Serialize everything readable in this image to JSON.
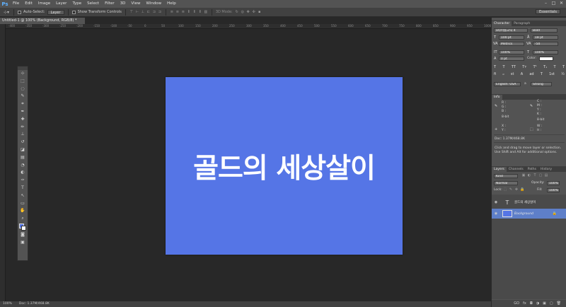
{
  "app": {
    "logo": "Ps",
    "menu": [
      "File",
      "Edit",
      "Image",
      "Layer",
      "Type",
      "Select",
      "Filter",
      "3D",
      "View",
      "Window",
      "Help"
    ],
    "window_controls": [
      "–",
      "□",
      "✕"
    ]
  },
  "options_bar": {
    "auto_select_label": "Auto-Select:",
    "auto_select_value": "Layer",
    "show_transform_label": "Show Transform Controls",
    "mode_label": "3D Mode:",
    "workspace": "Essentials"
  },
  "document": {
    "tab_title": "Untitled-1 @ 100% (Background, RGB/8) *",
    "canvas_color": "#5575e6",
    "canvas_text": "골드의 세상살이",
    "ruler_labels": [
      "-400",
      "-350",
      "-300",
      "-250",
      "-200",
      "-150",
      "-100",
      "-50",
      "0",
      "50",
      "100",
      "150",
      "200",
      "250",
      "300",
      "350",
      "400",
      "450",
      "500",
      "550",
      "600",
      "650",
      "700",
      "750",
      "800",
      "850",
      "900",
      "950",
      "1000",
      "1050"
    ]
  },
  "status": {
    "zoom": "100%",
    "doc_size": "Doc: 1.37M/468.8K"
  },
  "tools": {
    "icons": [
      "move-tool-icon",
      "marquee-tool-icon",
      "lasso-tool-icon",
      "quick-select-tool-icon",
      "crop-tool-icon",
      "eyedropper-tool-icon",
      "healing-brush-tool-icon",
      "brush-tool-icon",
      "clone-stamp-tool-icon",
      "history-brush-tool-icon",
      "eraser-tool-icon",
      "gradient-tool-icon",
      "blur-tool-icon",
      "dodge-tool-icon",
      "pen-tool-icon",
      "type-tool-icon",
      "path-select-tool-icon",
      "shape-tool-icon",
      "hand-tool-icon",
      "zoom-tool-icon"
    ],
    "glyphs": [
      "⊹",
      "⬚",
      "◌",
      "✎",
      "⌗",
      "✒",
      "✚",
      "✏",
      "⊥",
      "↺",
      "◪",
      "▤",
      "◔",
      "◐",
      "✑",
      "T",
      "↖",
      "▭",
      "✋",
      "⌕"
    ],
    "foreground_color": "#5575e6",
    "background_color": "#ffffff"
  },
  "character_panel": {
    "tabs": [
      "Character",
      "Paragraph"
    ],
    "font_family": "a타이틀고딕 4",
    "font_style": "Bold",
    "font_size": "100 pt",
    "leading": "18 pt",
    "kerning": "Metrics",
    "tracking": "-50",
    "vertical_scale": "100%",
    "horizontal_scale": "100%",
    "baseline_shift": "0 pt",
    "color_label": "Color:",
    "style_buttons": [
      "T",
      "T",
      "TT",
      "Tт",
      "T¹",
      "T₁",
      "T",
      "T"
    ],
    "opentype_buttons": [
      "fi",
      "ℴ",
      "st",
      "A",
      "ad",
      "T",
      "1st",
      "½"
    ],
    "language": "English: USA",
    "aa_label": "a",
    "antialias": "Strong"
  },
  "info_panel": {
    "tab": "Info",
    "rgb_labels": [
      "R :",
      "G :",
      "B :"
    ],
    "cmyk_labels": [
      "C :",
      "M :",
      "Y :",
      "K :"
    ],
    "bit_depth_left": "8-bit",
    "bit_depth_right": "8-bit",
    "xy_labels": [
      "X :",
      "Y :"
    ],
    "wh_labels": [
      "W :",
      "H :"
    ],
    "doc_size": "Doc: 1.37M/468.8K",
    "hint": "Click and drag to move layer or selection.  Use Shift and Alt for additional options."
  },
  "layers_panel": {
    "tabs": [
      "Layers",
      "Channels",
      "Paths",
      "History"
    ],
    "filter_kind": "Kind",
    "blend_mode": "Normal",
    "opacity_label": "Opacity:",
    "opacity": "100%",
    "lock_label": "Lock:",
    "fill_label": "Fill:",
    "fill": "100%",
    "layers": [
      {
        "name": "골드의 세상살이",
        "type": "text"
      },
      {
        "name": "Background",
        "type": "image"
      }
    ],
    "footer_icons": [
      "GO",
      "fx",
      "◘",
      "◑",
      "▣",
      "▢",
      "🗑"
    ]
  }
}
